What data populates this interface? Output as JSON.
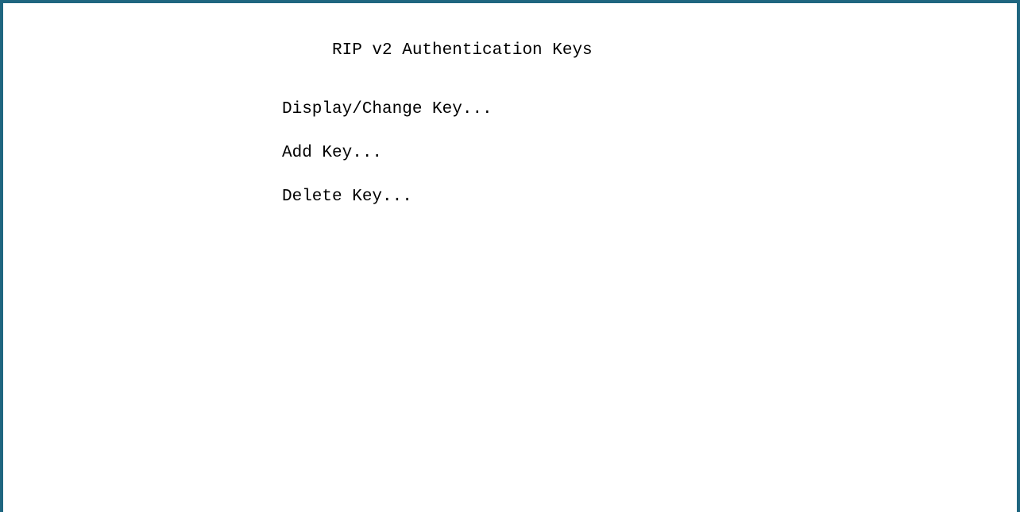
{
  "screen": {
    "title": "RIP v2 Authentication Keys"
  },
  "menu": {
    "items": [
      {
        "label": "Display/Change Key..."
      },
      {
        "label": "Add Key..."
      },
      {
        "label": "Delete Key..."
      }
    ]
  },
  "colors": {
    "border": "#1f6680",
    "background": "#ffffff",
    "text": "#000000"
  }
}
